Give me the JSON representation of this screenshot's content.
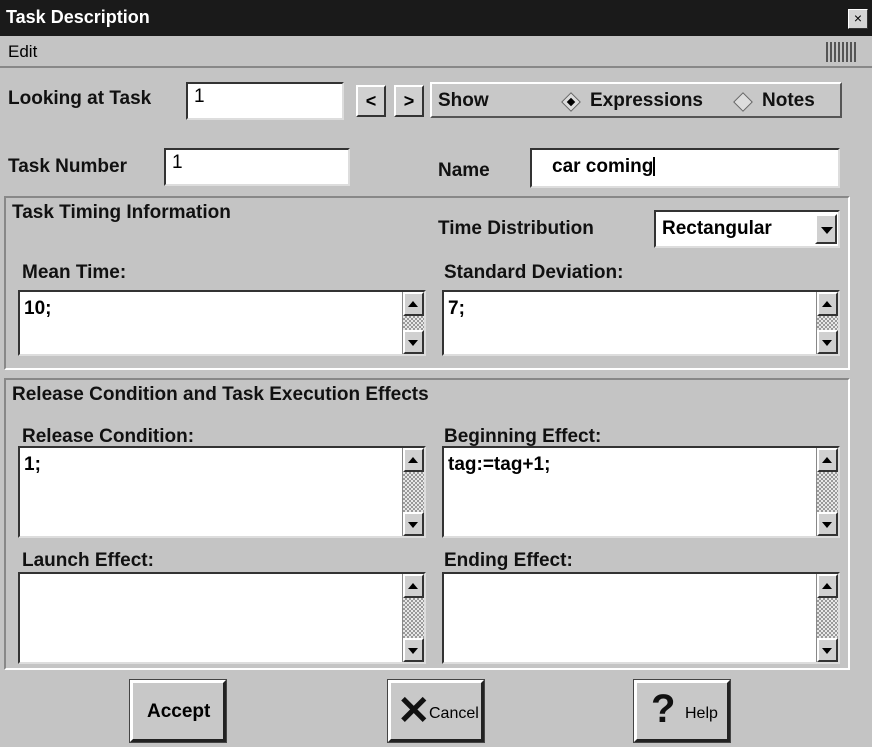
{
  "window": {
    "title": "Task Description",
    "close": "×"
  },
  "menu": {
    "edit": "Edit"
  },
  "looking": {
    "label": "Looking at Task",
    "value": "1",
    "prev": "<",
    "next": ">"
  },
  "show": {
    "label": "Show",
    "options": [
      "Expressions",
      "Notes"
    ],
    "selected": "Expressions"
  },
  "task": {
    "number_label": "Task Number",
    "number_value": "1",
    "name_label": "Name",
    "name_value": "car coming"
  },
  "timing": {
    "title": "Task Timing Information",
    "dist_label": "Time Distribution",
    "dist_value": "Rectangular",
    "mean_label": "Mean Time:",
    "mean_value": "10;",
    "sd_label": "Standard Deviation:",
    "sd_value": "7;"
  },
  "release": {
    "title": "Release Condition and Task Execution Effects",
    "cond_label": "Release Condition:",
    "cond_value": "1;",
    "begin_label": "Beginning Effect:",
    "begin_value": "tag:=tag+1;",
    "launch_label": "Launch Effect:",
    "launch_value": "",
    "end_label": "Ending Effect:",
    "end_value": ""
  },
  "buttons": {
    "accept": "Accept",
    "cancel": "Cancel",
    "help": "Help"
  }
}
